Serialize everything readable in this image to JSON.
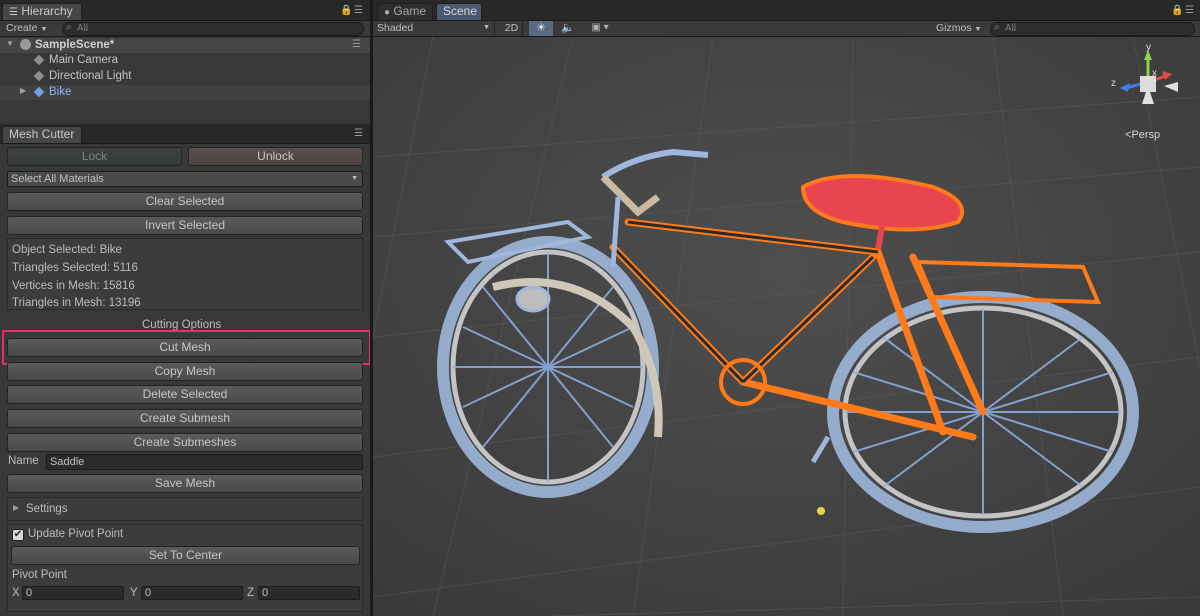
{
  "hierarchy": {
    "tab_label": "Hierarchy",
    "create_label": "Create",
    "search_placeholder": "All",
    "scene_name": "SampleScene*",
    "items": [
      {
        "label": "Main Camera"
      },
      {
        "label": "Directional Light"
      },
      {
        "label": "Bike"
      }
    ]
  },
  "mesh_cutter": {
    "tab_label": "Mesh Cutter",
    "lock_label": "Lock",
    "unlock_label": "Unlock",
    "material_select": "Select All Materials",
    "clear_selected": "Clear Selected",
    "invert_selected": "Invert Selected",
    "info": {
      "object_selected": "Object Selected: Bike",
      "triangles_selected": "Triangles Selected: 5116",
      "vertices_in_mesh": "Vertices in Mesh: 15816",
      "triangles_in_mesh": "Triangles in Mesh: 13196"
    },
    "cutting_options_label": "Cutting Options",
    "cut_mesh": "Cut Mesh",
    "copy_mesh": "Copy Mesh",
    "delete_selected": "Delete Selected",
    "create_submesh": "Create Submesh",
    "create_submeshes": "Create Submeshes",
    "name_label": "Name",
    "name_value": "Saddle",
    "save_mesh": "Save Mesh",
    "settings_label": "Settings",
    "update_pivot_label": "Update Pivot Point",
    "update_pivot_checked": true,
    "set_to_center": "Set To Center",
    "pivot_point_label": "Pivot Point",
    "pivot": {
      "x_label": "X",
      "x": "0",
      "y_label": "Y",
      "y": "0",
      "z_label": "Z",
      "z": "0"
    }
  },
  "scene_view": {
    "tabs": [
      {
        "label": "Game"
      },
      {
        "label": "Scene"
      }
    ],
    "shading_mode": "Shaded",
    "mode_2d": "2D",
    "gizmos_label": "Gizmos",
    "search_placeholder": "All",
    "axis_labels": {
      "x": "x",
      "y": "y",
      "z": "z"
    },
    "projection_label": "Persp"
  },
  "colors": {
    "highlight_box": "#e0306e",
    "selection_orange": "#ff7a1a",
    "selection_blue": "#7aa6e6",
    "saddle_red": "#e8454f"
  }
}
